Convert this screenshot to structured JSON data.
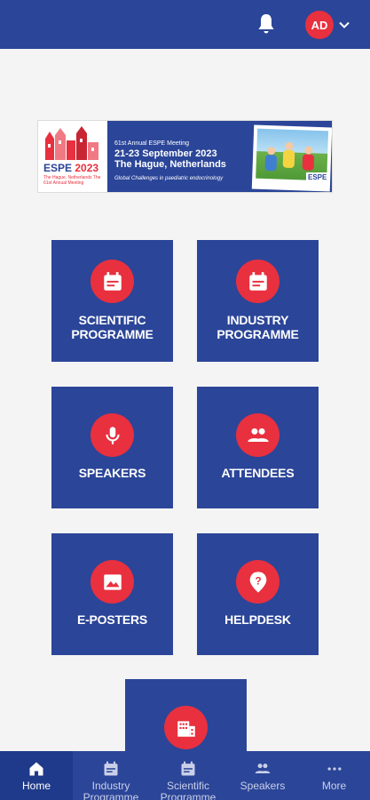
{
  "header": {
    "avatar_initials": "AD",
    "bell_icon": "bell-icon",
    "menu_icon": "chevron-down-icon"
  },
  "banner": {
    "logo_name": "ESPE",
    "logo_year": "2023",
    "logo_sub": "The Hague, Netherlands The 61st Annual Meeting",
    "line1": "61st Annual ESPE Meeting",
    "line2": "21-23 September 2023",
    "line3": "The Hague, Netherlands",
    "line4": "Global Challenges in paediatric endocrinology",
    "mark": "ESPE"
  },
  "tiles": [
    {
      "label": "SCIENTIFIC PROGRAMME",
      "icon": "calendar-icon"
    },
    {
      "label": "INDUSTRY PROGRAMME",
      "icon": "calendar-icon"
    },
    {
      "label": "SPEAKERS",
      "icon": "microphone-icon"
    },
    {
      "label": "ATTENDEES",
      "icon": "people-icon"
    },
    {
      "label": "E-POSTERS",
      "icon": "image-icon"
    },
    {
      "label": "HELPDESK",
      "icon": "help-icon"
    },
    {
      "label": "",
      "icon": "building-icon"
    }
  ],
  "tabbar": {
    "active": "Home",
    "items": [
      {
        "label": "Home",
        "icon": "home-icon"
      },
      {
        "label": "Industry Programme",
        "icon": "calendar-icon"
      },
      {
        "label": "Scientific Programme",
        "icon": "calendar-icon"
      },
      {
        "label": "Speakers",
        "icon": "people-icon"
      },
      {
        "label": "More",
        "icon": "more-dots-icon"
      }
    ]
  },
  "colors": {
    "primary": "#2b4598",
    "accent": "#e8303f",
    "background": "#f4f4f4"
  }
}
